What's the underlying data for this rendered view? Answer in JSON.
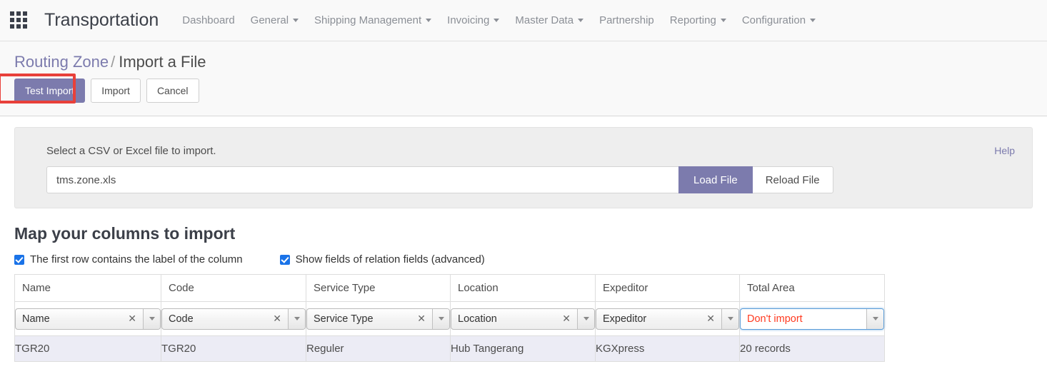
{
  "navbar": {
    "apps_icon": "apps-grid-icon",
    "brand": "Transportation",
    "menu": [
      {
        "label": "Dashboard",
        "has_caret": false
      },
      {
        "label": "General",
        "has_caret": true
      },
      {
        "label": "Shipping Management",
        "has_caret": true
      },
      {
        "label": "Invoicing",
        "has_caret": true
      },
      {
        "label": "Master Data",
        "has_caret": true
      },
      {
        "label": "Partnership",
        "has_caret": false
      },
      {
        "label": "Reporting",
        "has_caret": true
      },
      {
        "label": "Configuration",
        "has_caret": true
      }
    ]
  },
  "breadcrumb": {
    "parent": "Routing Zone",
    "separator": "/",
    "current": "Import a File"
  },
  "actions": {
    "test_import": "Test Import",
    "import": "Import",
    "cancel": "Cancel",
    "highlight_color": "#e8403a",
    "primary_color": "#7c7bad"
  },
  "file_panel": {
    "instruction": "Select a CSV or Excel file to import.",
    "help": "Help",
    "file_name": "tms.zone.xls",
    "file_placeholder": "",
    "load_file": "Load File",
    "reload_file": "Reload File"
  },
  "mapping": {
    "title": "Map your columns to import",
    "checkbox_first_row": "The first row contains the label of the column",
    "checkbox_relation_fields": "Show fields of relation fields (advanced)",
    "checkbox_color": "#1a73e8",
    "headers": [
      "Name",
      "Code",
      "Service Type",
      "Location",
      "Expeditor",
      "Total Area"
    ],
    "selects": [
      {
        "value": "Name",
        "clearable": true,
        "focused": false,
        "danger": false,
        "clear_glyph": "✕"
      },
      {
        "value": "Code",
        "clearable": true,
        "focused": false,
        "danger": false,
        "clear_glyph": "✕"
      },
      {
        "value": "Service Type",
        "clearable": true,
        "focused": false,
        "danger": false,
        "clear_glyph": "✕"
      },
      {
        "value": "Location",
        "clearable": true,
        "focused": false,
        "danger": false,
        "clear_glyph": "✕"
      },
      {
        "value": "Expeditor",
        "clearable": true,
        "focused": false,
        "danger": false,
        "clear_glyph": "✕"
      },
      {
        "value": "Don't import",
        "clearable": false,
        "focused": true,
        "danger": true,
        "clear_glyph": ""
      }
    ],
    "preview_row": [
      "TGR20",
      "TGR20",
      "Reguler",
      "Hub Tangerang",
      "KGXpress",
      "20 records"
    ]
  }
}
